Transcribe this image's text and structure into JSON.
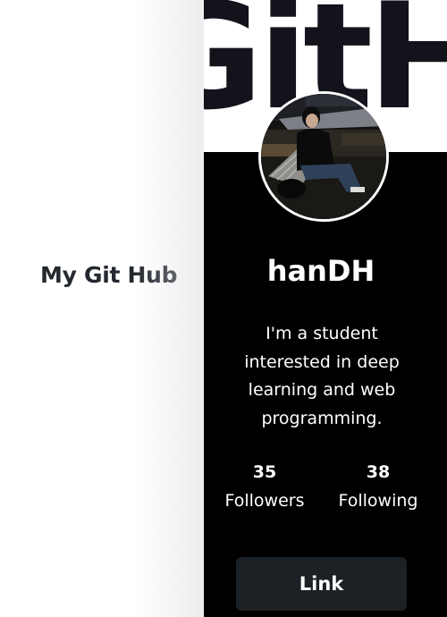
{
  "page": {
    "title": "My Git Hub"
  },
  "profile": {
    "banner_text": "GitHub",
    "avatar_alt": "profile photo",
    "username": "hanDH",
    "bio": "I'm a student interested in deep learning and web programming.",
    "stats": {
      "followers_count": "35",
      "followers_label": "Followers",
      "following_count": "38",
      "following_label": "Following"
    },
    "link_label": "Link"
  },
  "colors": {
    "card_background": "#000000",
    "button_background": "#1c2126",
    "title_text": "#24292f",
    "banner_text": "#13131c"
  }
}
